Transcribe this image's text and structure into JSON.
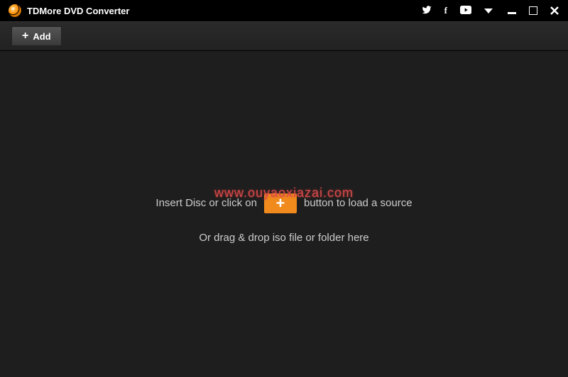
{
  "app": {
    "title": "TDMore DVD Converter"
  },
  "toolbar": {
    "add_label": "Add"
  },
  "main": {
    "watermark": "www.ouyaoxiazai.com",
    "instruction_before": "Insert Disc or click on",
    "instruction_after": "button to load a source",
    "instruction_sub": "Or drag & drop iso file or folder here"
  }
}
